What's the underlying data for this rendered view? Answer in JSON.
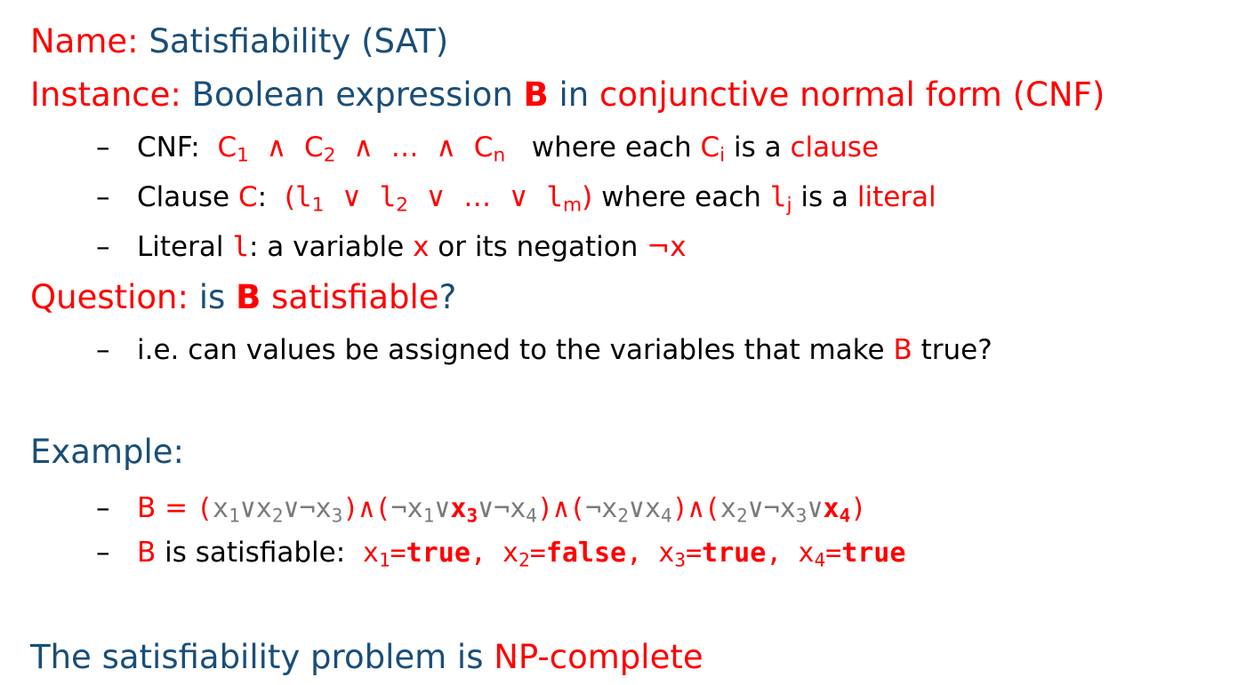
{
  "name": {
    "label": "Name:",
    "value": "Satisfiability (SAT)"
  },
  "instance": {
    "label": "Instance:",
    "text1": "Boolean expression",
    "var": "B",
    "text2": "in",
    "text3": "conjunctive normal form (CNF)"
  },
  "cnf": {
    "dash": "–",
    "label": "CNF:",
    "c": "C",
    "s1": "1",
    "s2": "2",
    "sn": "n",
    "si": "i",
    "and": "∧",
    "ellipsis": "…",
    "where": "where each",
    "is_a": "is a",
    "clause": "clause"
  },
  "clause": {
    "dash": "–",
    "label": "Clause",
    "c": "C",
    "colon": ":",
    "l": "l",
    "open": "(",
    "close": ")",
    "s1": "1",
    "s2": "2",
    "sm": "m",
    "sj": "j",
    "or": "∨",
    "ellipsis": "…",
    "where": "where each",
    "is_a": "is a",
    "literal": "literal"
  },
  "literal": {
    "dash": "–",
    "label": "Literal",
    "l": "l",
    "text1": ": a variable",
    "x": "x",
    "text2": "or its negation",
    "negx": "¬x"
  },
  "question": {
    "label": "Question:",
    "text1": "is",
    "var": "B",
    "text2": "satisfiable",
    "qmark": "?"
  },
  "ie": {
    "dash": "–",
    "text1": "i.e. can values be assigned to the variables that make",
    "var": "B",
    "text2": "true?"
  },
  "example": {
    "label": "Example:",
    "line1_dash": "–",
    "line1_lhs": "B = ",
    "line2_dash": "–",
    "line2_var": "B",
    "line2_text": "is satisfiable:",
    "true": "true",
    "false": "false",
    "comma": ",",
    "eq": "="
  },
  "conclusion": {
    "text": "The satisfiability problem is",
    "np": "NP-complete"
  }
}
